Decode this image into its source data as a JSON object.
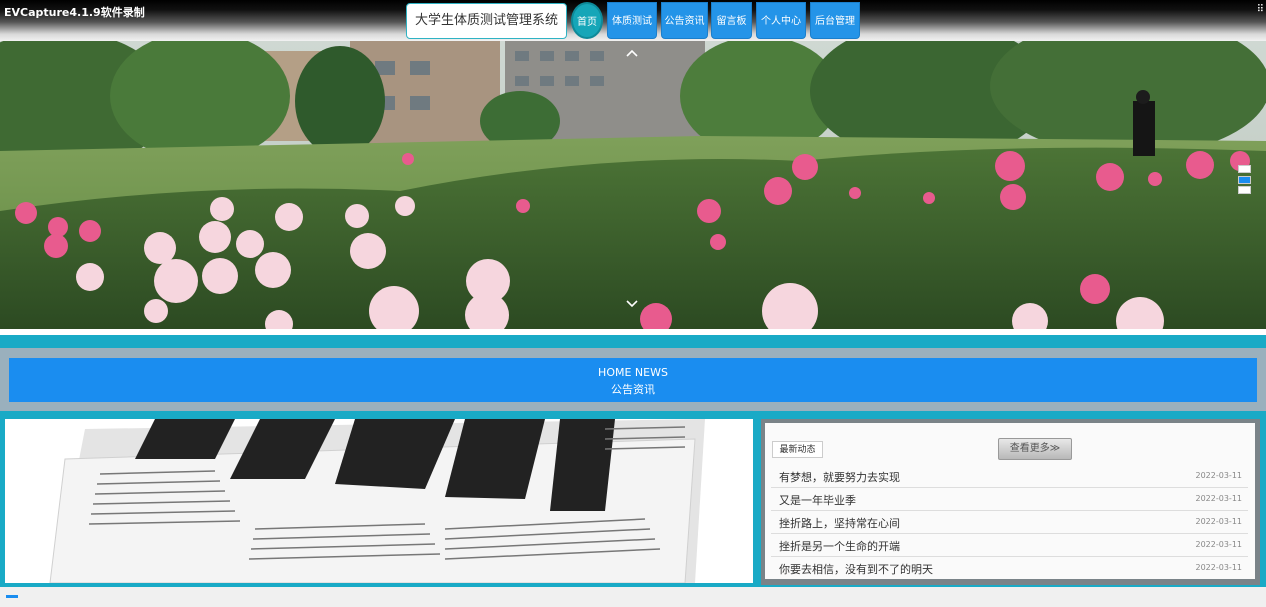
{
  "recorder": {
    "title": "EVCapture4.1.9软件录制",
    "controls": "⠿"
  },
  "header": {
    "site_title": "大学生体质测试管理系统",
    "nav": [
      "首页",
      "体质测试",
      "公告资讯",
      "留言板",
      "个人中心",
      "后台管理"
    ]
  },
  "banner": {
    "arrow_up": "up",
    "arrow_down": "down",
    "slides": 3,
    "active_slide": 2
  },
  "news_section": {
    "title_en": "HOME NEWS",
    "title_cn": "公告资讯"
  },
  "sidebar": {
    "tab_label": "最新动态",
    "more_label": "查看更多≫",
    "items": [
      {
        "title": "有梦想，就要努力去实现",
        "date": "2022-03-11"
      },
      {
        "title": "又是一年毕业季",
        "date": "2022-03-11"
      },
      {
        "title": "挫折路上，坚持常在心间",
        "date": "2022-03-11"
      },
      {
        "title": "挫折是另一个生命的开端",
        "date": "2022-03-11"
      },
      {
        "title": "你要去相信，没有到不了的明天",
        "date": "2022-03-11"
      }
    ]
  },
  "colors": {
    "accent": "#19aac6",
    "nav_blue": "#2494e8",
    "news_blue": "#1a8df0"
  }
}
